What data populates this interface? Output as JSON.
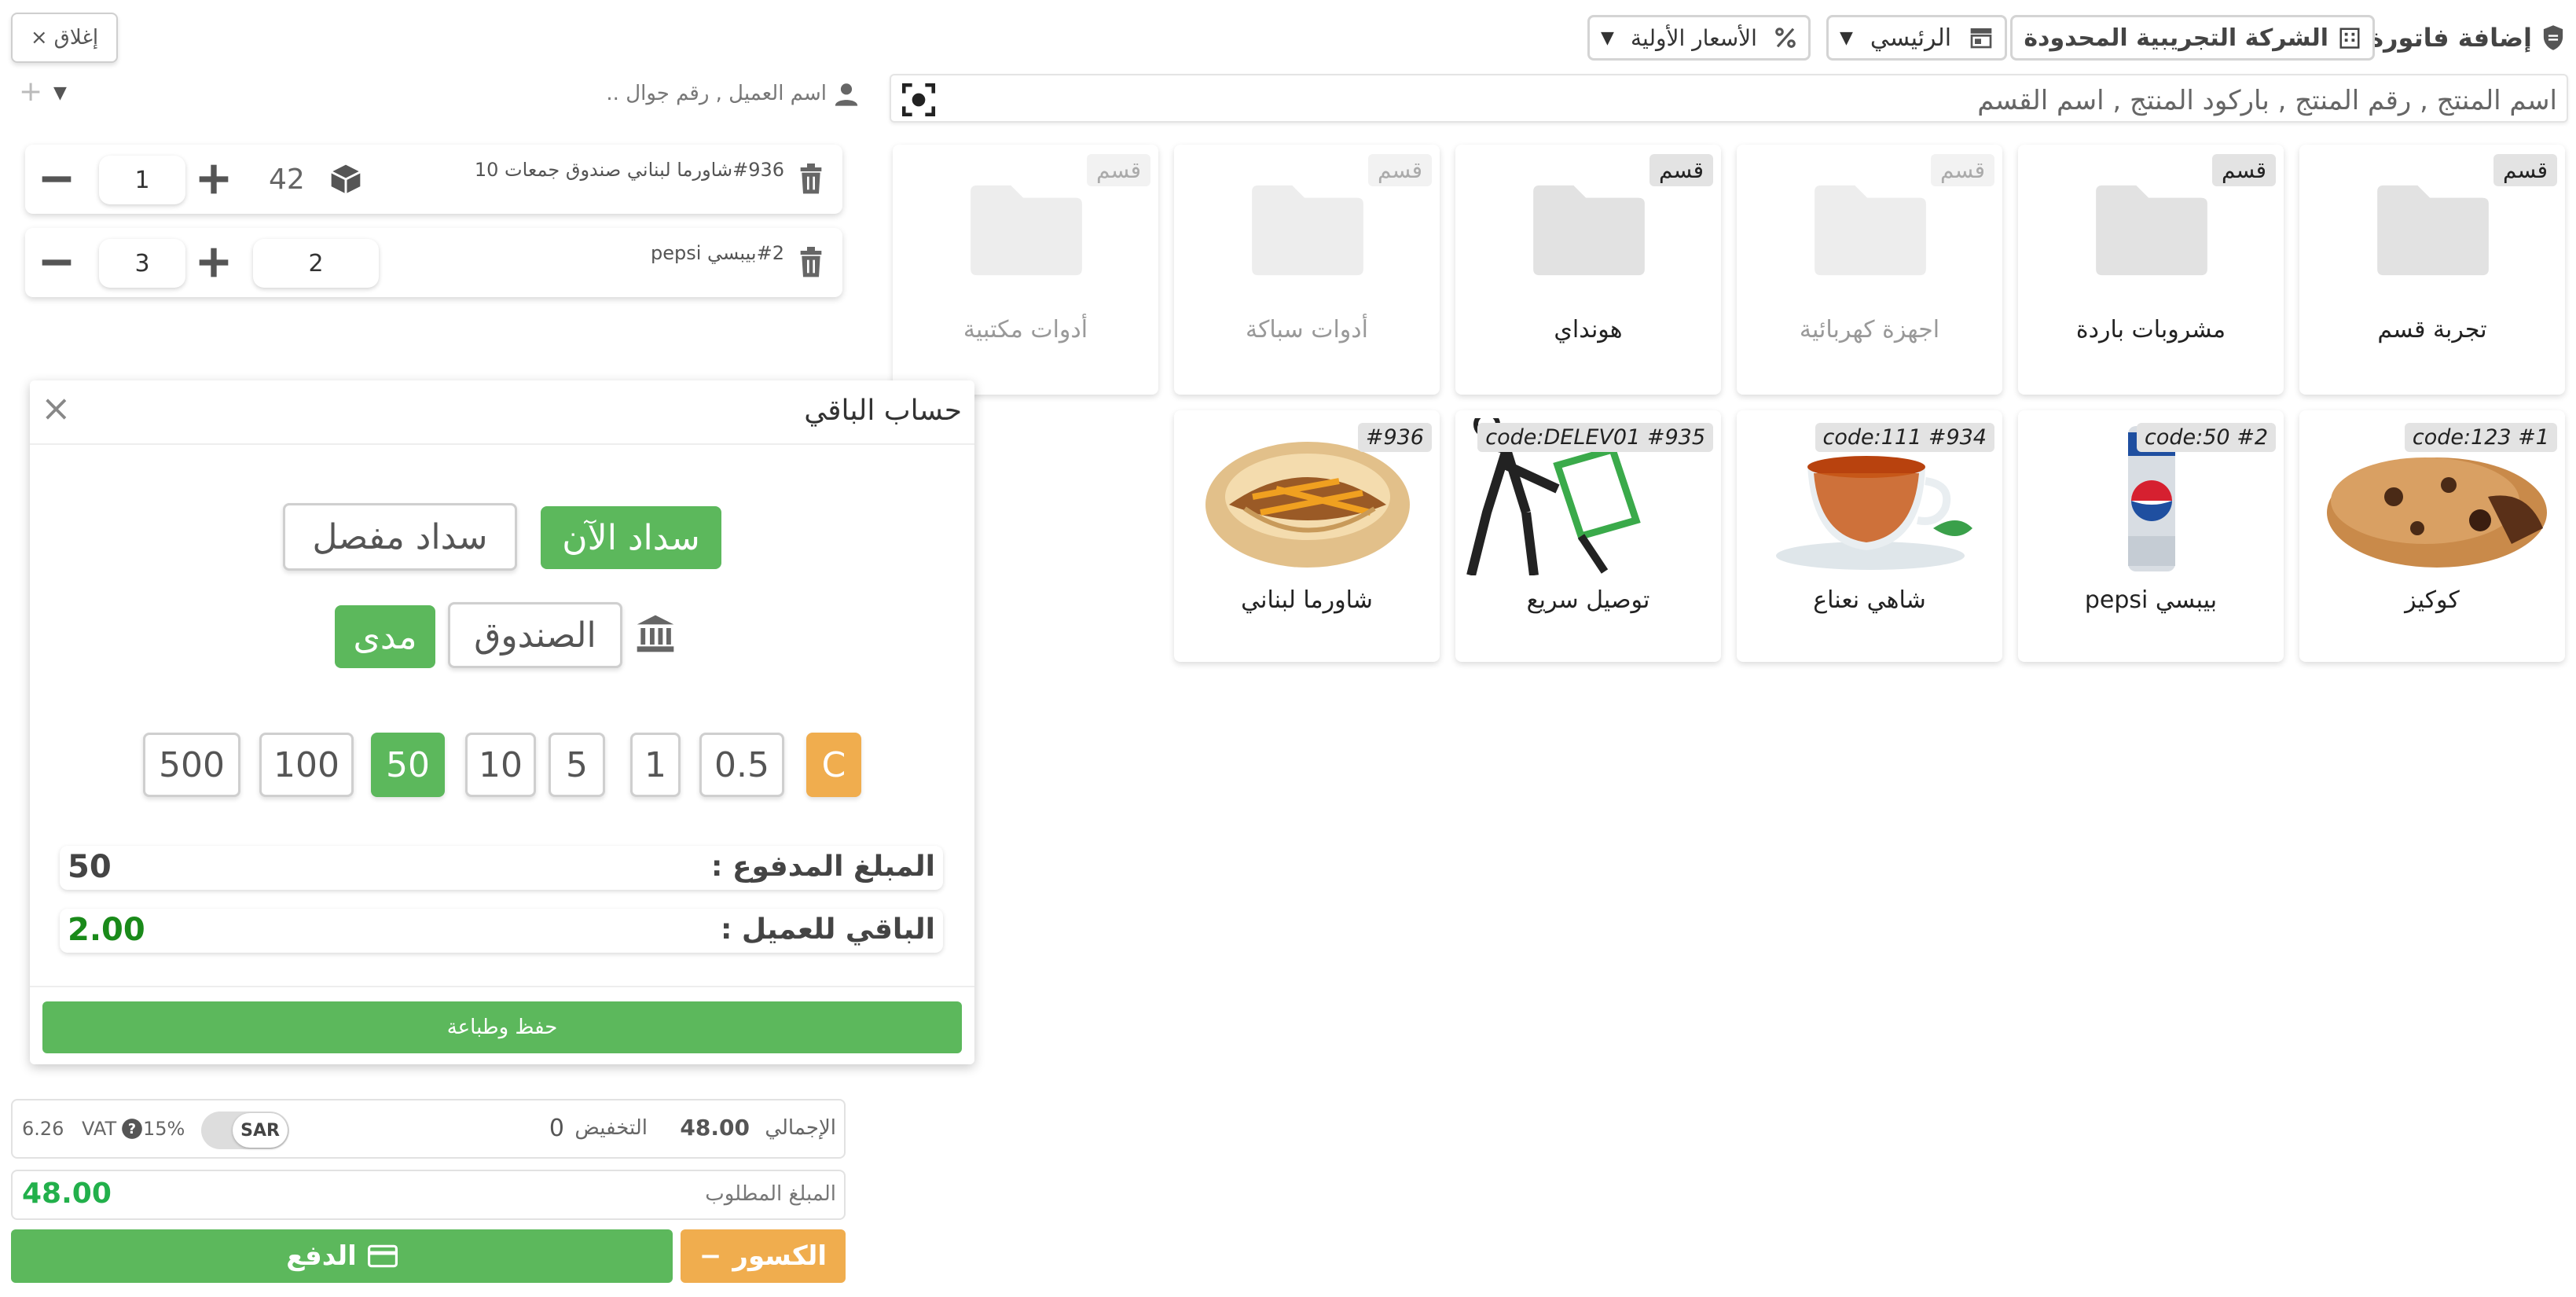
{
  "header": {
    "title": "إضافة فاتورة",
    "company": "الشركة التجريبية المحدودة",
    "branch": "الرئيسي",
    "price_list": "الأسعار الأولية",
    "close": "إغلاق"
  },
  "search": {
    "placeholder": "اسم المنتج , رقم المنتج , باركود المنتج , اسم القسم"
  },
  "customer": {
    "placeholder": "اسم العميل , رقم جوال ..",
    "add": "+"
  },
  "cart": [
    {
      "name": "#936شاورما لبناني صندوق جمعات 10",
      "qty": "1",
      "price": "42"
    },
    {
      "name": "#2بيبسي pepsi",
      "qty": "3",
      "price": "2"
    }
  ],
  "categories": [
    {
      "badge": "قسم",
      "label": "تجربة قسم",
      "active": true
    },
    {
      "badge": "قسم",
      "label": "مشروبات باردة",
      "active": true
    },
    {
      "badge": "قسم",
      "label": "اجهزة كهربائية",
      "active": false
    },
    {
      "badge": "قسم",
      "label": "هونداي",
      "active": true
    },
    {
      "badge": "قسم",
      "label": "أدوات سباكة",
      "active": false
    },
    {
      "badge": "قسم",
      "label": "أدوات مكتبية",
      "active": false
    }
  ],
  "products": [
    {
      "code": "code:123 #1",
      "label": "كوكيز"
    },
    {
      "code": "code:50 #2",
      "label": "بيبسي pepsi"
    },
    {
      "code": "code:111 #934",
      "label": "شاهي نعناع"
    },
    {
      "code": "code:DELEV01 #935",
      "label": "توصيل سريع"
    },
    {
      "code": "#936",
      "label": "شاورما لبناني"
    }
  ],
  "modal": {
    "title": "حساب الباقي",
    "pay_now": "سداد الآن",
    "pay_split": "سداد مفصل",
    "cashbox": "الصندوق",
    "mada": "مدى",
    "amounts": [
      "500",
      "100",
      "50",
      "10",
      "5",
      "1",
      "0.5",
      "C"
    ],
    "selected_amount": "50",
    "paid_label": "المبلغ المدفوع :",
    "paid_value": "50",
    "change_label": "الباقي للعميل :",
    "change_value": "2.00",
    "save_print": "حفظ وطباعة"
  },
  "totals": {
    "total_label": "الإجمالي",
    "total_value": "48.00",
    "discount_label": "التخفيض",
    "discount_value": "0",
    "currency": "SAR",
    "vat_label": "VAT",
    "vat_rate": "15%",
    "vat_value": "6.26",
    "required_label": "المبلغ المطلوب",
    "required_value": "48.00"
  },
  "footer": {
    "pay": "الدفع",
    "fractions": "الكسور"
  },
  "colors": {
    "green": "#5cb85c",
    "orange": "#f0ad4e",
    "required_green": "#22b04b",
    "change_green": "#1a8a1a"
  },
  "icons": [
    "shield-icon",
    "building-icon",
    "store-icon",
    "percent-icon",
    "scan-icon",
    "user-icon",
    "trash-icon",
    "box-icon",
    "folder-icon",
    "bank-icon",
    "card-icon",
    "question-icon"
  ]
}
